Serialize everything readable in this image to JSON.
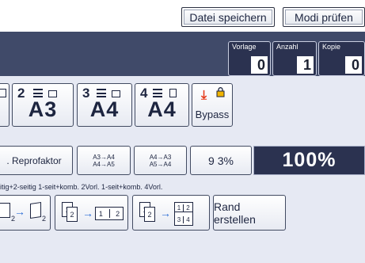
{
  "toolbar": {
    "save_label": "Datei speichern",
    "check_label": "Modi prüfen"
  },
  "counters": [
    {
      "label": "Vorlage",
      "value": "0"
    },
    {
      "label": "Anzahl",
      "value": "1"
    },
    {
      "label": "Kopie",
      "value": "0"
    }
  ],
  "paper_trays": [
    {
      "number": "2",
      "size": "A3"
    },
    {
      "number": "3",
      "size": "A4"
    },
    {
      "number": "4",
      "size": "A4"
    }
  ],
  "bypass": {
    "label": "Bypass",
    "icon": "bypass-arrow-icon"
  },
  "reduce_enlarge": {
    "auto_label": ". Reprofaktor",
    "preset1_top": "A3→A4",
    "preset1_bottom": "A4→A5",
    "preset2_top": "A4→A3",
    "preset2_bottom": "A5→A4",
    "preset3": "9 3%",
    "current": "100%"
  },
  "duplex_caption": "itig+2-seitig   1-seit+komb. 2Vorl.  1-seit+komb. 4Vorl.",
  "duplex_pages": {
    "two_a": "2",
    "two_b": "2",
    "p1": "1",
    "p2": "2",
    "p1b": "1",
    "p2b": "2",
    "p1c": "1",
    "p2c": "2",
    "p1d": "1",
    "p2d": "2",
    "p3d": "3",
    "p4d": "4"
  },
  "margin_button": "Rand erstellen",
  "colors": {
    "dark_header": "#404a69",
    "counter_bg": "#2b3250",
    "accent_blue": "#2e6fd6",
    "bypass_red": "#e53a1a",
    "lock_yellow": "#f0b400"
  }
}
